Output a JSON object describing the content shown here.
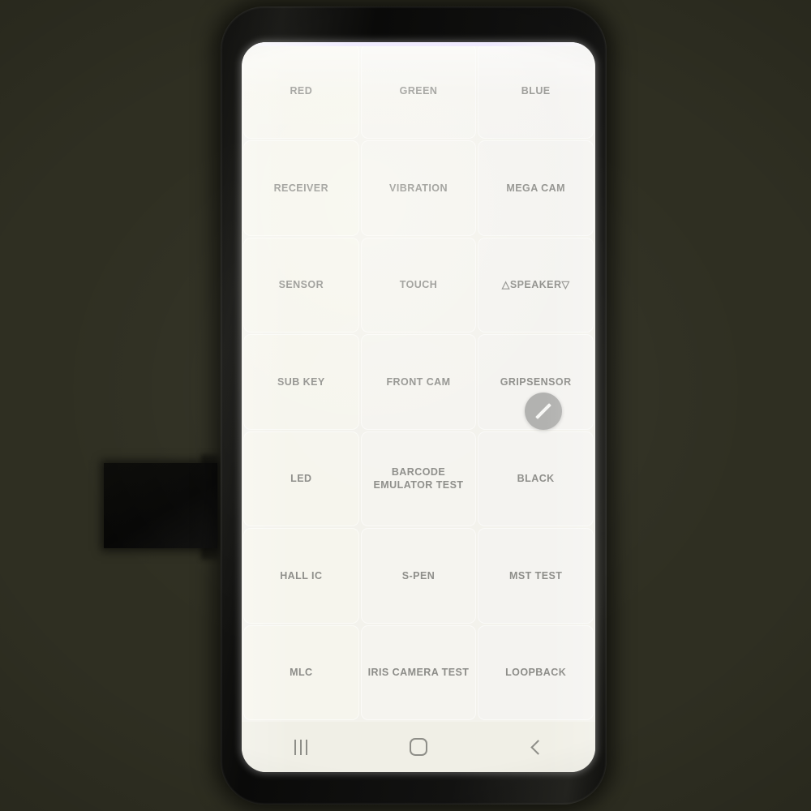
{
  "scene": {
    "background_color": "#2f2f22",
    "device_body_color": "#121210",
    "desk_object_label": "dark-rectangular-object"
  },
  "screen": {
    "background_color": "#f3f2ec",
    "tile_color": "#f5f4ee",
    "label_color": "#8c8c88"
  },
  "grid": {
    "columns": 3,
    "rows": 7,
    "tiles": [
      {
        "label": "RED",
        "name": "tile-red"
      },
      {
        "label": "GREEN",
        "name": "tile-green"
      },
      {
        "label": "BLUE",
        "name": "tile-blue"
      },
      {
        "label": "RECEIVER",
        "name": "tile-receiver"
      },
      {
        "label": "VIBRATION",
        "name": "tile-vibration"
      },
      {
        "label": "MEGA CAM",
        "name": "tile-mega-cam"
      },
      {
        "label": "SENSOR",
        "name": "tile-sensor"
      },
      {
        "label": "TOUCH",
        "name": "tile-touch"
      },
      {
        "label": "△SPEAKER▽",
        "name": "tile-speaker"
      },
      {
        "label": "SUB KEY",
        "name": "tile-sub-key"
      },
      {
        "label": "FRONT CAM",
        "name": "tile-front-cam"
      },
      {
        "label": "GRIPSENSOR",
        "name": "tile-gripsensor"
      },
      {
        "label": "LED",
        "name": "tile-led"
      },
      {
        "label": "BARCODE EMULATOR TEST",
        "name": "tile-barcode-emulator-test",
        "wrap": true
      },
      {
        "label": "BLACK",
        "name": "tile-black"
      },
      {
        "label": "HALL IC",
        "name": "tile-hall-ic"
      },
      {
        "label": "S-PEN",
        "name": "tile-s-pen"
      },
      {
        "label": "MST TEST",
        "name": "tile-mst-test"
      },
      {
        "label": "MLC",
        "name": "tile-mlc"
      },
      {
        "label": "IRIS CAMERA TEST",
        "name": "tile-iris-camera-test"
      },
      {
        "label": "LOOPBACK",
        "name": "tile-loopback"
      }
    ]
  },
  "floating_button": {
    "icon": "stylus-pen-icon",
    "background_color": "#969694"
  },
  "navbar": {
    "background_color": "#f0efe6",
    "icon_color": "#8e8e88",
    "buttons": [
      {
        "name": "nav-recents-button",
        "icon": "recent-apps-icon"
      },
      {
        "name": "nav-home-button",
        "icon": "home-icon"
      },
      {
        "name": "nav-back-button",
        "icon": "back-chevron-icon"
      }
    ]
  }
}
